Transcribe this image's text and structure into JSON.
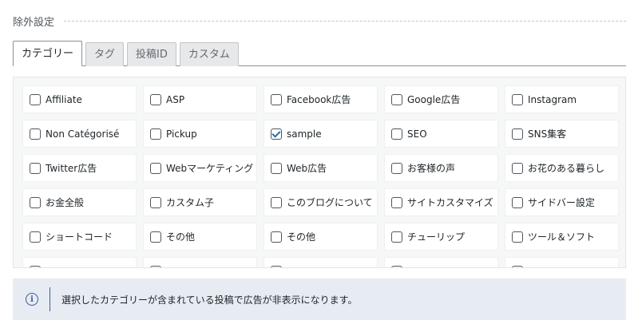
{
  "section": {
    "title": "除外設定"
  },
  "tabs": [
    {
      "label": "カテゴリー",
      "active": true
    },
    {
      "label": "タグ",
      "active": false
    },
    {
      "label": "投稿ID",
      "active": false
    },
    {
      "label": "カスタム",
      "active": false
    }
  ],
  "terms": [
    {
      "label": "Affiliate",
      "checked": false
    },
    {
      "label": "ASP",
      "checked": false
    },
    {
      "label": "Facebook広告",
      "checked": false
    },
    {
      "label": "Google広告",
      "checked": false
    },
    {
      "label": "Instagram",
      "checked": false
    },
    {
      "label": "Non Catégorisé",
      "checked": false
    },
    {
      "label": "Pickup",
      "checked": false
    },
    {
      "label": "sample",
      "checked": true
    },
    {
      "label": "SEO",
      "checked": false
    },
    {
      "label": "SNS集客",
      "checked": false
    },
    {
      "label": "Twitter広告",
      "checked": false
    },
    {
      "label": "Webマーケティング",
      "checked": false
    },
    {
      "label": "Web広告",
      "checked": false
    },
    {
      "label": "お客様の声",
      "checked": false
    },
    {
      "label": "お花のある暮らし",
      "checked": false
    },
    {
      "label": "お金全般",
      "checked": false
    },
    {
      "label": "カスタム子",
      "checked": false
    },
    {
      "label": "このブログについて",
      "checked": false
    },
    {
      "label": "サイトカスタマイズ",
      "checked": false
    },
    {
      "label": "サイドバー設定",
      "checked": false
    },
    {
      "label": "ショートコード",
      "checked": false
    },
    {
      "label": "その他",
      "checked": false
    },
    {
      "label": "その他",
      "checked": false
    },
    {
      "label": "チューリップ",
      "checked": false
    },
    {
      "label": "ツール＆ソフト",
      "checked": false
    },
    {
      "label": "",
      "checked": false
    },
    {
      "label": "",
      "checked": false
    },
    {
      "label": "",
      "checked": false
    },
    {
      "label": "",
      "checked": false
    },
    {
      "label": "",
      "checked": false
    }
  ],
  "notice": {
    "icon": "info-icon",
    "text": "選択したカテゴリーが含まれている投稿で広告が非表示になります。"
  }
}
